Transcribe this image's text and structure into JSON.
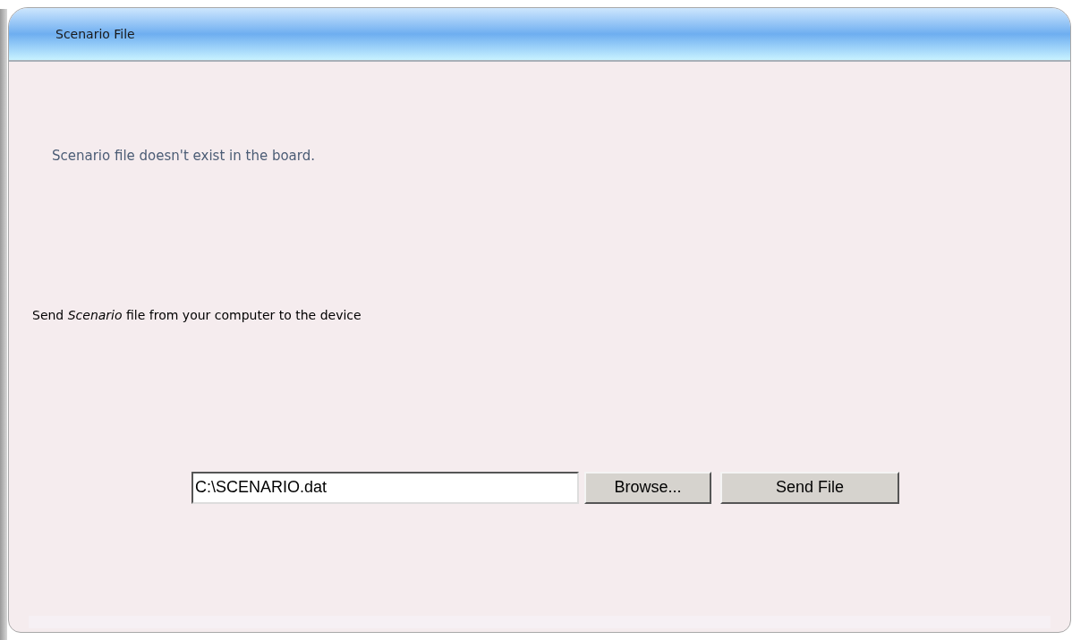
{
  "panel": {
    "title": "Scenario File"
  },
  "status_message": "Scenario file doesn't exist in the board.",
  "instruction": "Send *Scenario* file from your computer to the device",
  "file_field": {
    "value": "C:\\SCENARIO.dat"
  },
  "buttons": [
    "Browse...",
    "Send File"
  ]
}
